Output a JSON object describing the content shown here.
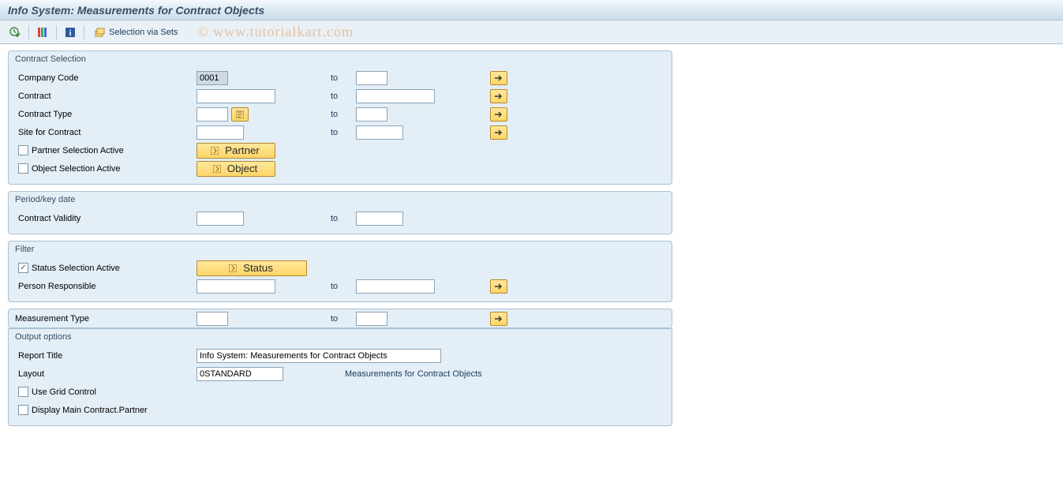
{
  "title": "Info System: Measurements for Contract Objects",
  "toolbar": {
    "selection_via_sets": "Selection via Sets"
  },
  "watermark": "© www.tutorialkart.com",
  "groups": {
    "contract_selection": {
      "title": "Contract Selection",
      "company_code_label": "Company Code",
      "company_code_from": "0001",
      "company_code_to": "",
      "contract_label": "Contract",
      "contract_from": "",
      "contract_to": "",
      "contract_type_label": "Contract Type",
      "contract_type_from": "",
      "contract_type_to": "",
      "site_label": "Site for Contract",
      "site_from": "",
      "site_to": "",
      "partner_sel_label": "Partner Selection Active",
      "partner_btn": "Partner",
      "object_sel_label": "Object Selection Active",
      "object_btn": "Object",
      "to": "to"
    },
    "period": {
      "title": "Period/key date",
      "validity_label": "Contract Validity",
      "validity_from": "",
      "validity_to": "",
      "to": "to"
    },
    "filter": {
      "title": "Filter",
      "status_sel_label": "Status Selection Active",
      "status_btn": "Status",
      "person_label": "Person Responsible",
      "person_from": "",
      "person_to": "",
      "to": "to"
    },
    "meas": {
      "label": "Measurement Type",
      "from": "",
      "toval": "",
      "to": "to"
    },
    "output": {
      "title": "Output options",
      "report_title_label": "Report Title",
      "report_title_value": "Info System: Measurements for Contract Objects",
      "layout_label": "Layout",
      "layout_value": "0STANDARD",
      "layout_desc": "Measurements for Contract Objects",
      "grid_label": "Use Grid Control",
      "display_partner_label": "Display Main Contract.Partner"
    }
  }
}
